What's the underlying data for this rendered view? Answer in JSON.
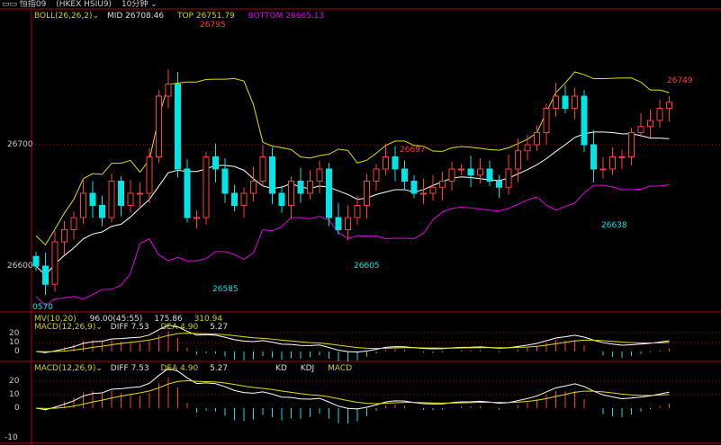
{
  "header": {
    "icon": "window-icon",
    "symbol": "恒指09",
    "code": "(HKEX HSIU9)",
    "period": "10分钟"
  },
  "main": {
    "indicator": "BOLL(26,26,2)",
    "mid": "MID 26708.46",
    "top": "TOP 26751.79",
    "bottom": "BOTTOM 26665.13",
    "y_labels": [
      "26700",
      "26600"
    ],
    "annotations": [
      {
        "text": "26795",
        "color": "#ff3b3b"
      },
      {
        "text": "26585",
        "color": "#00e5e5"
      },
      {
        "text": "26605",
        "color": "#00e5e5"
      },
      {
        "text": "26697",
        "color": "#ff3b3b"
      },
      {
        "text": "26638",
        "color": "#00e5e5"
      },
      {
        "text": "26749",
        "color": "#ff3b3b"
      },
      {
        "text": "0570",
        "color": "#00e5e5"
      }
    ],
    "closes": [
      26600,
      26585,
      26620,
      26630,
      26640,
      26660,
      26650,
      26640,
      26670,
      26650,
      26660,
      26660,
      26690,
      26740,
      26750,
      26680,
      26640,
      26640,
      26690,
      26680,
      26660,
      26650,
      26660,
      26670,
      26690,
      26660,
      26650,
      26670,
      26660,
      26670,
      26680,
      26640,
      26630,
      26640,
      26650,
      26670,
      26680,
      26690,
      26680,
      26670,
      26660,
      26660,
      26665,
      26670,
      26680,
      26680,
      26675,
      26680,
      26670,
      26665,
      26680,
      26695,
      26700,
      26710,
      26730,
      26740,
      26730,
      26740,
      26700,
      26680,
      26680,
      26690,
      26690,
      26710,
      26715,
      26720,
      26730,
      26735
    ]
  },
  "panel1": {
    "mv": "MV(10,20)",
    "mv1": "96.00(45:55)",
    "mv2": "175.86",
    "mv3": "310.94",
    "macd": "MACD(12,26,9)",
    "diff": "DIFF 7.53",
    "dea": "DEA 4.90",
    "val": "5.27",
    "y_labels": [
      "20",
      "10",
      "0"
    ]
  },
  "panel2": {
    "macd": "MACD(12,26,9)",
    "diff": "DIFF 7.53",
    "dea": "DEA 4.90",
    "val": "5.27",
    "tabs": [
      "KD",
      "KDJ",
      "MACD"
    ],
    "y_labels": [
      "20",
      "10",
      "0",
      "-10"
    ]
  },
  "colors": {
    "up": "#ff3b3b",
    "down": "#00e5e5",
    "mid": "#ffffff",
    "band_top": "#e0e000",
    "band_bottom": "#e000e0",
    "grid": "#b00000"
  }
}
